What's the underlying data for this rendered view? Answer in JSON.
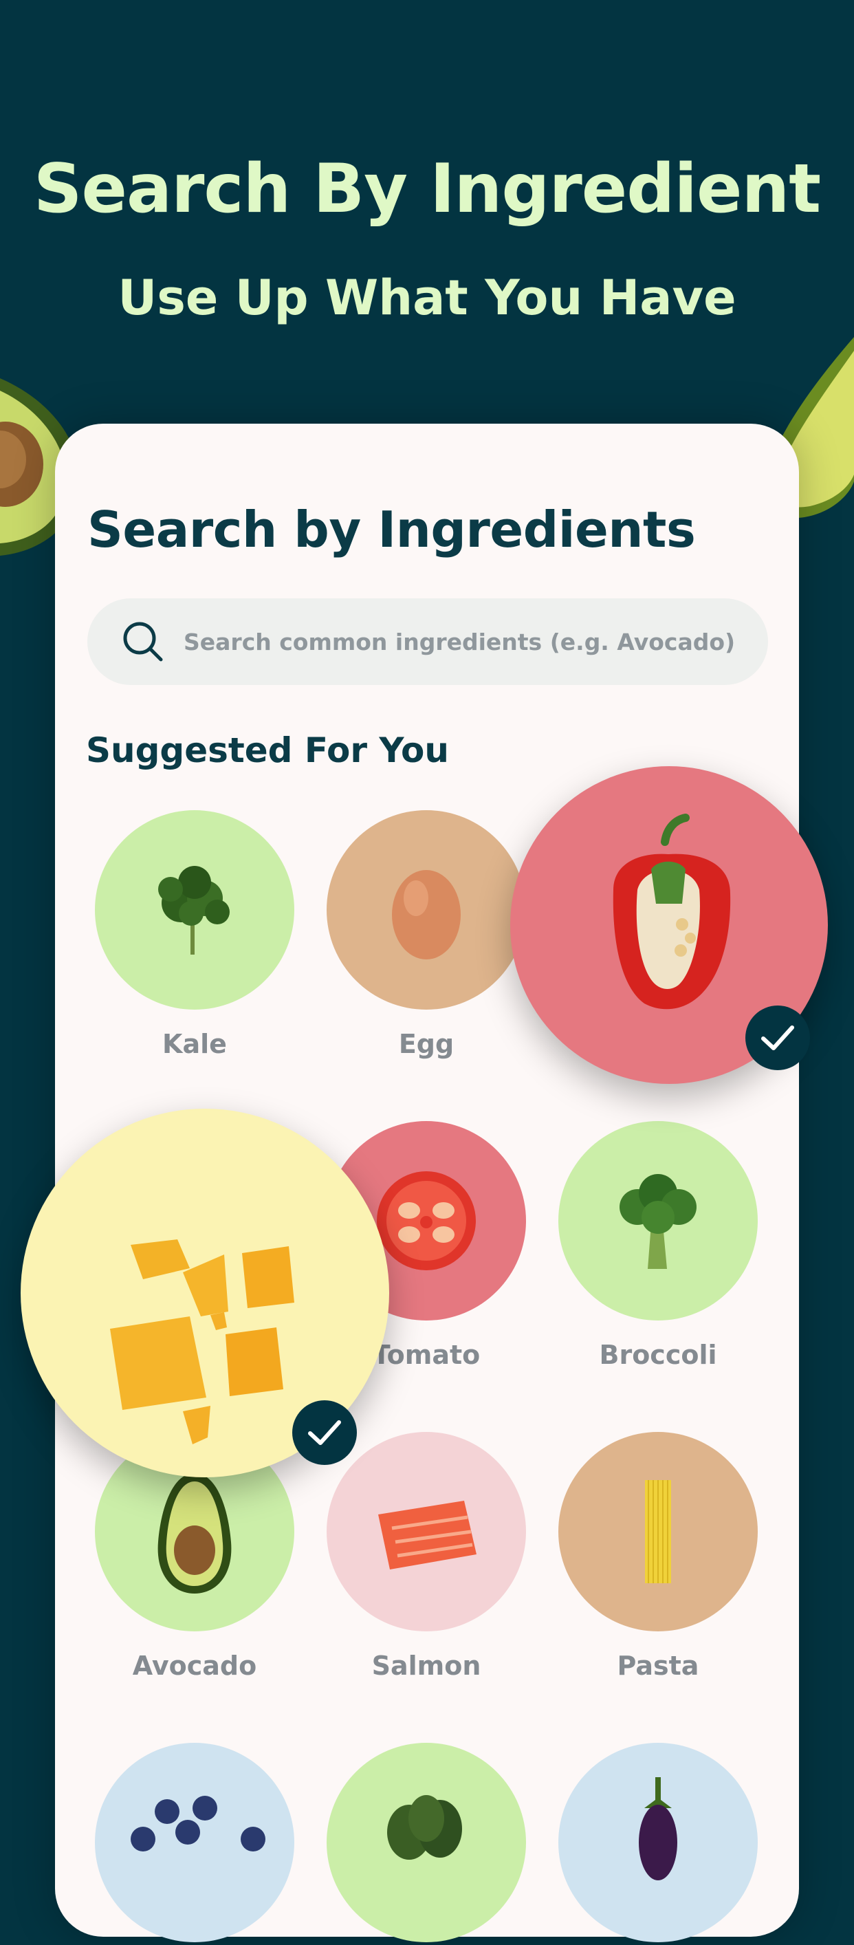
{
  "promo": {
    "title": "Search By Ingredient",
    "subtitle": "Use Up What You Have"
  },
  "card": {
    "title": "Search by Ingredients",
    "search": {
      "placeholder": "Search common ingredients (e.g. Avocado)"
    },
    "section_title": "Suggested For You"
  },
  "ingredients": [
    {
      "label": "Kale",
      "bg": "#cbeea8",
      "icon": "kale-icon"
    },
    {
      "label": "Egg",
      "bg": "#deb48c",
      "icon": "egg-icon"
    },
    {
      "label": "Bell Pepper",
      "bg": "#e57880",
      "icon": "bell-pepper-icon",
      "selected": true
    },
    {
      "label": "Cheese",
      "bg": "#fbf3b3",
      "icon": "cheese-icon",
      "selected": true
    },
    {
      "label": "Tomato",
      "bg": "#e57880",
      "icon": "tomato-icon"
    },
    {
      "label": "Broccoli",
      "bg": "#cbeea8",
      "icon": "broccoli-icon"
    },
    {
      "label": "Avocado",
      "bg": "#cbeea8",
      "icon": "avocado-icon"
    },
    {
      "label": "Salmon",
      "bg": "#f4d3d6",
      "icon": "salmon-icon"
    },
    {
      "label": "Pasta",
      "bg": "#deb48c",
      "icon": "pasta-icon"
    },
    {
      "label": "",
      "bg": "#cfe3f0",
      "icon": "blueberries-icon"
    },
    {
      "label": "",
      "bg": "#cbeea8",
      "icon": "spinach-icon"
    },
    {
      "label": "",
      "bg": "#cfe3f0",
      "icon": "eggplant-icon"
    }
  ],
  "colors": {
    "background": "#033441",
    "accent": "#dff8c6",
    "card": "#fdf8f7",
    "check": "#033441"
  }
}
